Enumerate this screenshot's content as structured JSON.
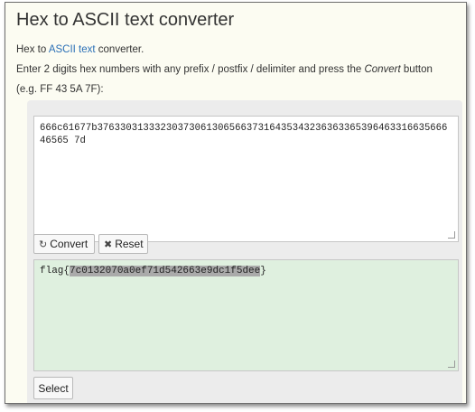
{
  "header": {
    "title": "Hex to ASCII text converter"
  },
  "intro": {
    "prefix": "Hex to ",
    "link": "ASCII text",
    "suffix": " converter."
  },
  "instructions": {
    "pre": "Enter 2 digits hex numbers with any prefix / postfix / delimiter and press the ",
    "emphasis": "Convert",
    "post": " button",
    "example": "(e.g. FF 43 5A 7F):"
  },
  "input": {
    "value": "666c61677b376330313332303730613065663731643534323636336539646331663566646565 7d"
  },
  "buttons": {
    "convert": "Convert",
    "reset": "Reset",
    "select": "Select"
  },
  "icons": {
    "convert": "refresh-icon",
    "reset": "close-icon"
  },
  "output": {
    "prefix": "flag{",
    "highlight": "7c0132070a0ef71d542663e9dc1f5dee",
    "suffix": "}"
  }
}
